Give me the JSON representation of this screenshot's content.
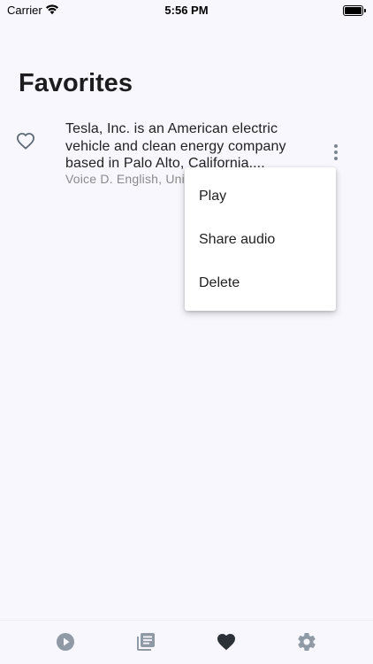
{
  "status_bar": {
    "carrier": "Carrier",
    "time": "5:56 PM"
  },
  "page": {
    "title": "Favorites"
  },
  "favorites": [
    {
      "description": "Tesla, Inc. is an American electric vehicle and clean energy company based in Palo Alto, California....",
      "subtitle": "Voice D. English, Uni",
      "favorited": true
    }
  ],
  "menu": {
    "items": [
      "Play",
      "Share audio",
      "Delete"
    ]
  },
  "bottom_nav": {
    "items": [
      {
        "icon": "play-circle-icon",
        "active": false
      },
      {
        "icon": "library-icon",
        "active": false
      },
      {
        "icon": "heart-icon",
        "active": true
      },
      {
        "icon": "gear-icon",
        "active": false
      }
    ]
  },
  "colors": {
    "background": "#f8f7fd",
    "text": "#222222",
    "secondary_text": "#8a8a8a",
    "nav_inactive": "#8f9aa6",
    "nav_active": "#2b3137",
    "heart_outline": "#5f6b76"
  }
}
